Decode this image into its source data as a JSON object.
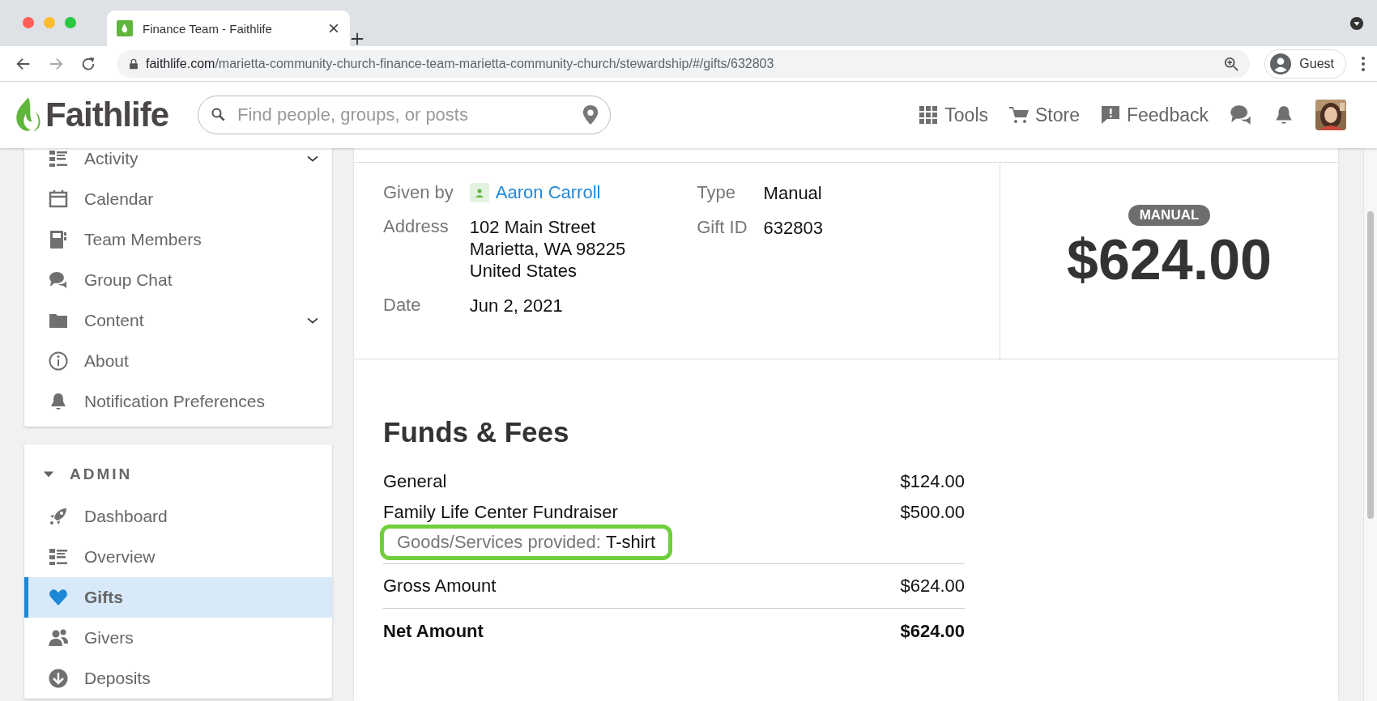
{
  "browser": {
    "tab": {
      "title": "Finance Team - Faithlife",
      "selected": true
    },
    "url_host": "faithlife.com",
    "url_path": "/marietta-community-church-finance-team-marietta-community-church/stewardship/#/gifts/632803",
    "profile": "Guest"
  },
  "header": {
    "brand": "Faithlife",
    "search": {
      "placeholder": "Find people, groups, or posts"
    },
    "nav": [
      "Tools",
      "Store",
      "Feedback"
    ]
  },
  "sidebar": {
    "items": [
      {
        "label": "Activity",
        "expandable": true,
        "selected": false
      },
      {
        "label": "Calendar",
        "expandable": false,
        "selected": false
      },
      {
        "label": "Team Members",
        "expandable": false,
        "selected": false
      },
      {
        "label": "Group Chat",
        "expandable": false,
        "selected": false
      },
      {
        "label": "Content",
        "expandable": true,
        "selected": false
      },
      {
        "label": "About",
        "expandable": false,
        "selected": false
      },
      {
        "label": "Notification Preferences",
        "expandable": false,
        "selected": false
      }
    ],
    "admin": {
      "title": "ADMIN",
      "expanded": true,
      "items": [
        {
          "label": "Dashboard",
          "selected": false
        },
        {
          "label": "Overview",
          "selected": false
        },
        {
          "label": "Gifts",
          "selected": true
        },
        {
          "label": "Givers",
          "selected": false
        },
        {
          "label": "Deposits",
          "selected": false
        }
      ]
    }
  },
  "gift": {
    "given_by": {
      "label": "Given by",
      "name": "Aaron Carroll"
    },
    "left": [
      {
        "label": "Address",
        "lines": [
          "102 Main Street",
          "Marietta, WA 98225",
          "United States"
        ]
      },
      {
        "label": "Date",
        "lines": [
          "Jun 2, 2021"
        ]
      }
    ],
    "right": [
      {
        "label": "Type",
        "lines": [
          "Manual"
        ]
      },
      {
        "label": "Gift ID",
        "lines": [
          "632803"
        ]
      }
    ],
    "badge": "MANUAL",
    "amount": "$624.00"
  },
  "funds": {
    "title": "Funds & Fees",
    "rows": [
      {
        "kind": "fund",
        "label": "General",
        "amount": "$124.00"
      },
      {
        "kind": "fund",
        "label": "Family Life Center Fundraiser",
        "amount": "$500.00"
      },
      {
        "kind": "note",
        "label": "Goods/Services provided:",
        "value": "T-shirt"
      },
      {
        "kind": "gross",
        "label": "Gross Amount",
        "amount": "$624.00"
      },
      {
        "kind": "net",
        "label": "Net Amount",
        "amount": "$624.00"
      }
    ]
  }
}
